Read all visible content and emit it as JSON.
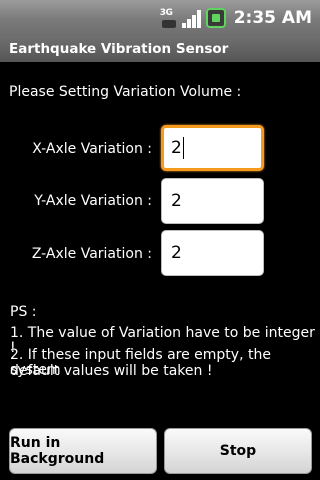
{
  "status_bar": {
    "network_label": "3G",
    "time": "2:35 AM"
  },
  "title_bar": {
    "title": "Earthquake Vibration Sensor"
  },
  "form": {
    "prompt": "Please Setting Variation Volume :",
    "rows": [
      {
        "label": "X-Axle Variation :",
        "value": "2",
        "focused": true
      },
      {
        "label": "Y-Axle Variation :",
        "value": "2",
        "focused": false
      },
      {
        "label": "Z-Axle Variation :",
        "value": "2",
        "focused": false
      }
    ]
  },
  "notes": {
    "heading": "PS :",
    "line1": "1. The value of Variation have to be integer !",
    "line2a": "2. If these input fields are empty, the system",
    "line2b": "default values will be taken !"
  },
  "buttons": {
    "run_background": "Run in Background",
    "stop": "Stop"
  },
  "colors": {
    "focus": "#f49a1e",
    "battery": "#5fd45f"
  }
}
